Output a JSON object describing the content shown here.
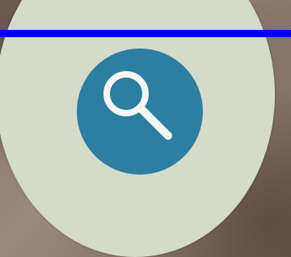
{
  "background": {
    "description_color": "#8b7a70"
  },
  "guide_line": {
    "color": "#0000ee"
  },
  "disc": {
    "color": "#d5dbcb"
  },
  "search_button": {
    "icon": "search-icon",
    "color": "#2d7ea1",
    "icon_color": "#f4f7f4"
  }
}
